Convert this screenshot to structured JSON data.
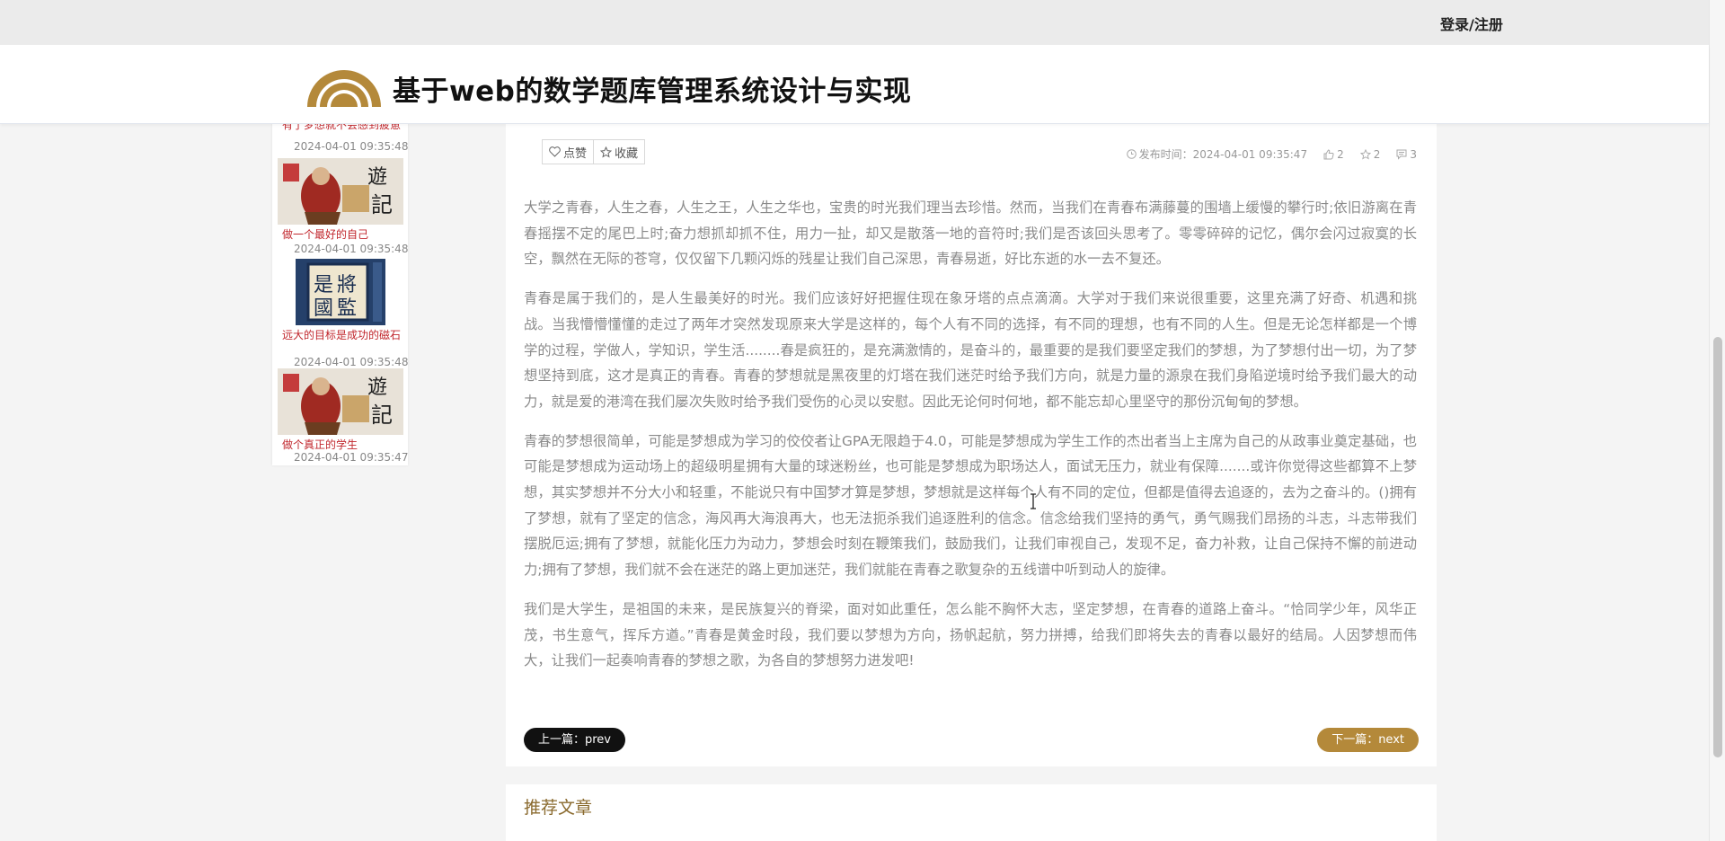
{
  "topbar": {
    "login_label": "登录/注册"
  },
  "header": {
    "site_title": "基于web的数学题库管理系统设计与实现"
  },
  "sidebar": {
    "top_item": {
      "title": "有了梦想就不会感到疲惫",
      "date": "2024-04-01 09:35:48"
    },
    "items": [
      {
        "title": "做一个最好的自己",
        "date": "2024-04-01 09:35:48",
        "thumb": "journey-west-painting"
      },
      {
        "title": "远大的目标是成功的磁石",
        "date": "2024-04-01 09:35:48",
        "thumb": "calligraphy-book"
      },
      {
        "title": "做个真正的学生",
        "date": "2024-04-01 09:35:47",
        "thumb": "journey-west-painting"
      }
    ]
  },
  "article": {
    "like_label": "点赞",
    "favorite_label": "收藏",
    "publish_label": "发布时间：2024-04-01 09:35:47",
    "like_count": "2",
    "favorite_count": "2",
    "comment_count": "3",
    "paragraphs": [
      "大学之青春，人生之春，人生之王，人生之华也，宝贵的时光我们理当去珍惜。然而，当我们在青春布满藤蔓的围墙上缓慢的攀行时;依旧游离在青春摇摆不定的尾巴上时;奋力想抓却抓不住，用力一扯，却又是散落一地的音符时;我们是否该回头思考了。零零碎碎的记忆，偶尔会闪过寂寞的长空，飘然在无际的苍穹，仅仅留下几颗闪烁的残星让我们自己深思，青春易逝，好比东逝的水一去不复还。",
      "青春是属于我们的，是人生最美好的时光。我们应该好好把握住现在象牙塔的点点滴滴。大学对于我们来说很重要，这里充满了好奇、机遇和挑战。当我懵懵懂懂的走过了两年才突然发现原来大学是这样的，每个人有不同的选择，有不同的理想，也有不同的人生。但是无论怎样都是一个博学的过程，学做人，学知识，学生活........春是疯狂的，是充满激情的，是奋斗的，最重要的是我们要坚定我们的梦想，为了梦想付出一切，为了梦想坚持到底，这才是真正的青春。青春的梦想就是黑夜里的灯塔在我们迷茫时给予我们方向，就是力量的源泉在我们身陷逆境时给予我们最大的动力，就是爱的港湾在我们屡次失败时给予我们受伤的心灵以安慰。因此无论何时何地，都不能忘却心里坚守的那份沉甸甸的梦想。",
      "青春的梦想很简单，可能是梦想成为学习的佼佼者让GPA无限趋于4.0，可能是梦想成为学生工作的杰出者当上主席为自己的从政事业奠定基础，也可能是梦想成为运动场上的超级明星拥有大量的球迷粉丝，也可能是梦想成为职场达人，面试无压力，就业有保障.......或许你觉得这些都算不上梦想，其实梦想并不分大小和轻重，不能说只有中国梦才算是梦想，梦想就是这样每个人有不同的定位，但都是值得去追逐的，去为之奋斗的。()拥有了梦想，就有了坚定的信念，海风再大海浪再大，也无法扼杀我们追逐胜利的信念。信念给我们坚持的勇气，勇气赐我们昂扬的斗志，斗志带我们摆脱厄运;拥有了梦想，就能化压力为动力，梦想会时刻在鞭策我们，鼓励我们，让我们审视自己，发现不足，奋力补救，让自己保持不懈的前进动力;拥有了梦想，我们就不会在迷茫的路上更加迷茫，我们就能在青春之歌复杂的五线谱中听到动人的旋律。",
      "我们是大学生，是祖国的未来，是民族复兴的脊梁，面对如此重任，怎么能不胸怀大志，坚定梦想，在青春的道路上奋斗。“恰同学少年，风华正茂，书生意气，挥斥方遒。”青春是黄金时段，我们要以梦想为方向，扬帆起航，努力拼搏，给我们即将失去的青春以最好的结局。人因梦想而伟大，让我们一起奏响青春的梦想之歌，为各自的梦想努力进发吧!"
    ],
    "prev_label": "上一篇：prev",
    "next_label": "下一篇：next"
  },
  "recommend": {
    "title": "推荐文章"
  },
  "colors": {
    "accent_gold": "#b4893a",
    "sidebar_title_red": "#c1272d"
  }
}
